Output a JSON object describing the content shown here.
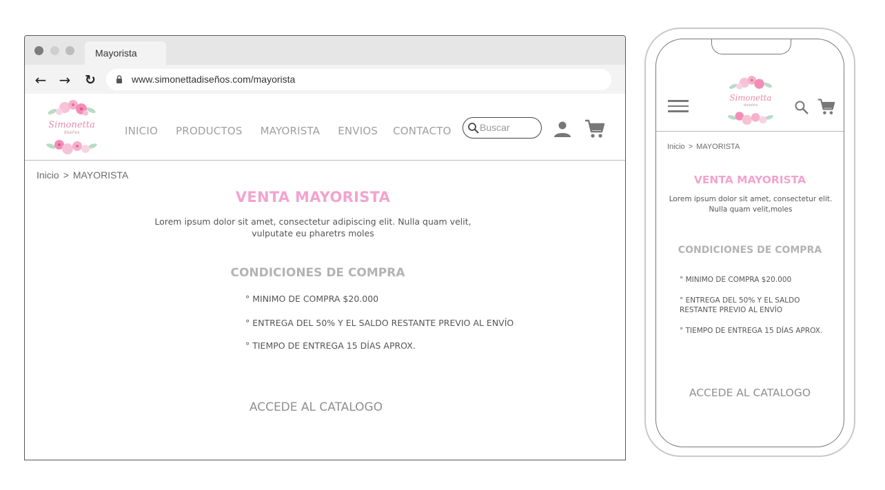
{
  "browser": {
    "tab_title": "Mayorista",
    "url": "www.simonettadiseños.com/mayorista",
    "icons": {
      "back": "back-arrow-icon",
      "forward": "forward-arrow-icon",
      "reload": "reload-icon",
      "lock": "lock-icon"
    }
  },
  "brand": {
    "name": "Simonetta",
    "tagline": "diseños",
    "colors": {
      "accent_pink": "#f3a3cf",
      "logo_pink": "#e68aad",
      "nav_gray": "#9f9f9f"
    }
  },
  "nav": {
    "items": [
      {
        "label": "INICIO"
      },
      {
        "label": "PRODUCTOS"
      },
      {
        "label": "MAYORISTA"
      },
      {
        "label": "ENVIOS"
      },
      {
        "label": "CONTACTO"
      }
    ],
    "search_placeholder": "Buscar"
  },
  "breadcrumb": {
    "home": "Inicio",
    "separator": ">",
    "current": "MAYORISTA"
  },
  "page": {
    "title": "VENTA MAYORISTA",
    "intro": "Lorem ipsum dolor sit amet, consectetur adipiscing elit. Nulla quam velit, vulputate eu pharetrs moles",
    "conditions_title": "CONDICIONES DE COMPRA",
    "conditions": [
      "° MINIMO DE COMPRA $20.000",
      "° ENTREGA DEL 50%  Y EL SALDO RESTANTE PREVIO AL ENVÍO",
      "° TIEMPO DE ENTREGA 15 DÍAS APROX."
    ],
    "catalog_cta": "ACCEDE AL CATALOGO"
  },
  "mobile": {
    "intro": "Lorem ipsum dolor sit amet, consectetur  elit. Nulla quam velit,moles",
    "icons": {
      "menu": "hamburger-menu-icon",
      "search": "search-icon",
      "cart": "cart-icon"
    }
  }
}
